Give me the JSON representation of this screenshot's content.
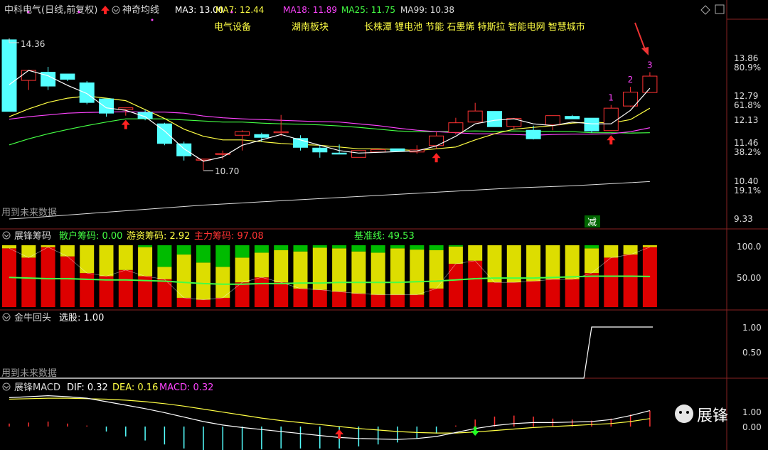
{
  "main": {
    "stock": "中科电气(日线,前复权)",
    "indicator": "神奇均线",
    "ma": [
      {
        "label": "MA3: 13.00",
        "color": "#ffffff"
      },
      {
        "label": "MA7: 12.44",
        "color": "#ffff44"
      },
      {
        "label": "MA18: 11.89",
        "color": "#ff44ff"
      },
      {
        "label": "MA25: 11.75",
        "color": "#44ff44"
      },
      {
        "label": "MA99: 10.38",
        "color": "#dddddd"
      }
    ],
    "tags": [
      "电气设备",
      "湖南板块",
      "长株潭 锂电池 节能 石墨烯 特斯拉 智能电网 智慧城市"
    ],
    "prices": [
      "13.86",
      "12.79",
      "12.13",
      "11.46",
      "10.40",
      "9.33"
    ],
    "pcts": [
      "80.9%",
      "61.8%",
      "38.2%",
      "19.1%"
    ],
    "high_label": "14.36",
    "low_label": "10.70",
    "future": "用到未来数据",
    "jian": "减",
    "steps": [
      "1",
      "2",
      "3"
    ]
  },
  "chip": {
    "title": "展锋筹码",
    "retail": "散户筹码: 0.00",
    "hot": "游资筹码: 2.92",
    "main_force": "主力筹码: 97.08",
    "baseline": "基准线: 49.53",
    "scale": [
      "100.0",
      "50.00"
    ]
  },
  "bull": {
    "title": "金牛回头",
    "select": "选股: 1.00",
    "scale": [
      "1.00",
      "0.50"
    ],
    "future": "用到未来数据",
    "values": [
      0,
      0,
      0,
      0,
      0,
      0,
      0,
      0,
      0,
      0,
      0,
      0,
      0,
      0,
      0,
      0,
      0,
      0,
      0,
      0,
      0,
      0,
      0,
      0,
      0,
      0,
      0,
      0,
      0,
      0,
      1,
      1,
      1
    ]
  },
  "macd": {
    "title": "展锋MACD",
    "dif": "DIF: 0.32",
    "dea": "DEA: 0.16",
    "macd": "MACD: 0.32",
    "scale": [
      "1.00",
      "0.00"
    ]
  },
  "watermark": "展锋",
  "colors": {
    "up": "#ff3333",
    "down": "#54ffff",
    "ma3": "#ffffff",
    "ma7": "#ffff44",
    "ma18": "#ff44ff",
    "ma25": "#44ff44",
    "ma99": "#dddddd",
    "chip_red": "#dd0000",
    "chip_yellow": "#dddd00",
    "chip_green": "#00bb00"
  },
  "chart_data": {
    "type": "candlestick",
    "ohlc": [
      [
        14.36,
        13.86,
        12.35,
        12.35
      ],
      [
        13.22,
        13.5,
        12.95,
        13.5
      ],
      [
        13.45,
        13.6,
        12.95,
        13.06
      ],
      [
        13.4,
        13.4,
        13.2,
        13.25
      ],
      [
        13.15,
        13.2,
        12.55,
        12.6
      ],
      [
        12.7,
        12.7,
        12.2,
        12.3
      ],
      [
        12.4,
        12.45,
        12.23,
        12.45
      ],
      [
        12.32,
        12.4,
        12.1,
        12.15
      ],
      [
        12.0,
        12.03,
        11.4,
        11.45
      ],
      [
        11.44,
        11.5,
        10.97,
        11.1
      ],
      [
        10.98,
        11.02,
        10.7,
        11.01
      ],
      [
        11.15,
        11.25,
        11.0,
        11.17
      ],
      [
        11.68,
        11.82,
        11.25,
        11.78
      ],
      [
        11.7,
        11.75,
        11.5,
        11.62
      ],
      [
        11.75,
        12.25,
        11.65,
        11.78
      ],
      [
        11.59,
        11.68,
        11.25,
        11.34
      ],
      [
        11.32,
        11.4,
        11.05,
        11.21
      ],
      [
        11.18,
        11.42,
        11.15,
        11.15
      ],
      [
        11.06,
        11.25,
        11.06,
        11.25
      ],
      [
        11.21,
        11.29,
        11.2,
        11.28
      ],
      [
        11.3,
        11.29,
        11.25,
        11.24
      ],
      [
        11.21,
        11.4,
        11.16,
        11.27
      ],
      [
        11.39,
        11.77,
        11.3,
        11.66
      ],
      [
        11.76,
        12.17,
        11.7,
        12.03
      ],
      [
        12.05,
        12.59,
        12.05,
        12.36
      ],
      [
        12.35,
        12.35,
        11.96,
        11.92
      ],
      [
        11.93,
        12.16,
        11.86,
        12.15
      ],
      [
        11.82,
        11.95,
        11.56,
        11.58
      ],
      [
        11.97,
        12.16,
        11.82,
        12.23
      ],
      [
        12.21,
        12.25,
        12.2,
        12.14
      ],
      [
        12.16,
        12.16,
        11.75,
        11.8
      ],
      [
        11.81,
        12.53,
        11.8,
        12.44
      ],
      [
        12.5,
        13.04,
        12.48,
        12.89
      ],
      [
        12.88,
        13.45,
        12.88,
        13.34
      ]
    ],
    "ma3": [
      13.1,
      13.5,
      13.35,
      13.08,
      12.85,
      12.45,
      12.38,
      12.2,
      11.8,
      11.3,
      10.95,
      11.07,
      11.4,
      11.55,
      11.7,
      11.55,
      11.4,
      11.25,
      11.18,
      11.2,
      11.22,
      11.24,
      11.38,
      11.65,
      12.0,
      12.1,
      12.14,
      12.0,
      11.95,
      12.05,
      12.0,
      12.0,
      12.38,
      13.0
    ],
    "ma7": [
      12.2,
      12.42,
      12.6,
      12.72,
      12.78,
      12.72,
      12.65,
      12.4,
      12.15,
      11.85,
      11.65,
      11.55,
      11.55,
      11.5,
      11.45,
      11.42,
      11.4,
      11.35,
      11.3,
      11.3,
      11.28,
      11.25,
      11.3,
      11.35,
      11.55,
      11.72,
      11.85,
      11.9,
      11.95,
      12.02,
      12.05,
      12.02,
      12.12,
      12.44
    ],
    "ma18": [
      12.13,
      12.2,
      12.25,
      12.3,
      12.32,
      12.33,
      12.34,
      12.33,
      12.33,
      12.3,
      12.22,
      12.17,
      12.14,
      12.12,
      12.1,
      12.08,
      12.06,
      12.05,
      12.0,
      11.95,
      11.88,
      11.82,
      11.78,
      11.75,
      11.72,
      11.72,
      11.7,
      11.68,
      11.7,
      11.71,
      11.71,
      11.72,
      11.78,
      11.89
    ],
    "ma25": [
      11.41,
      11.58,
      11.72,
      11.84,
      11.95,
      12.05,
      12.14,
      12.14,
      12.14,
      12.11,
      12.08,
      12.05,
      12.05,
      12.02,
      12.0,
      11.99,
      11.97,
      11.94,
      11.9,
      11.85,
      11.8,
      11.78,
      11.78,
      11.79,
      11.8,
      11.79,
      11.8,
      11.79,
      11.79,
      11.78,
      11.75,
      11.75,
      11.74,
      11.75
    ],
    "ma99": [
      9.33,
      9.36,
      9.4,
      9.44,
      9.48,
      9.52,
      9.56,
      9.6,
      9.64,
      9.68,
      9.72,
      9.75,
      9.78,
      9.81,
      9.84,
      9.87,
      9.9,
      9.93,
      9.96,
      9.99,
      10.02,
      10.05,
      10.08,
      10.11,
      10.14,
      10.17,
      10.2,
      10.22,
      10.24,
      10.26,
      10.29,
      10.32,
      10.35,
      10.38
    ],
    "chip_red": [
      95,
      80,
      97,
      82,
      55,
      50,
      60,
      50,
      45,
      15,
      12,
      15,
      40,
      48,
      40,
      30,
      28,
      25,
      22,
      20,
      20,
      20,
      30,
      70,
      75,
      40,
      40,
      42,
      45,
      45,
      55,
      80,
      85,
      97
    ],
    "chip_yellow": [
      5,
      20,
      3,
      18,
      45,
      50,
      40,
      47,
      20,
      70,
      60,
      50,
      40,
      40,
      52,
      60,
      68,
      70,
      68,
      68,
      75,
      73,
      62,
      28,
      25,
      60,
      60,
      58,
      55,
      55,
      40,
      20,
      15,
      3
    ],
    "chip_baseline": [
      48,
      47,
      46,
      46,
      45,
      44,
      44,
      43,
      42,
      40,
      38,
      37,
      37,
      38,
      38,
      39,
      39,
      40,
      40,
      40,
      40,
      41,
      42,
      44,
      46,
      47,
      47,
      47,
      48,
      49,
      50,
      50,
      50,
      49.53
    ],
    "dif": [
      0.58,
      0.6,
      0.62,
      0.6,
      0.57,
      0.5,
      0.43,
      0.36,
      0.28,
      0.19,
      0.1,
      0.03,
      -0.02,
      -0.06,
      -0.1,
      -0.14,
      -0.18,
      -0.22,
      -0.24,
      -0.25,
      -0.26,
      -0.24,
      -0.2,
      -0.12,
      -0.04,
      0.02,
      0.06,
      0.08,
      0.08,
      0.09,
      0.1,
      0.14,
      0.22,
      0.32
    ],
    "dea": [
      0.55,
      0.56,
      0.57,
      0.57,
      0.56,
      0.55,
      0.53,
      0.5,
      0.46,
      0.41,
      0.35,
      0.29,
      0.23,
      0.17,
      0.12,
      0.08,
      0.04,
      0.0,
      -0.04,
      -0.07,
      -0.1,
      -0.12,
      -0.13,
      -0.13,
      -0.11,
      -0.08,
      -0.05,
      -0.02,
      0.0,
      0.02,
      0.04,
      0.06,
      0.1,
      0.16
    ]
  }
}
